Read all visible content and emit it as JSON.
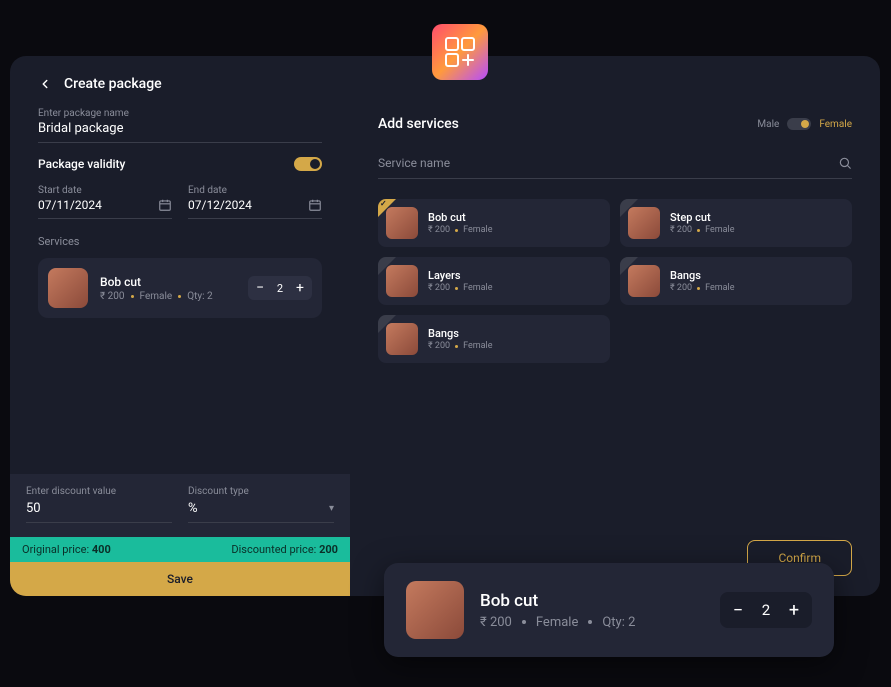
{
  "page_title": "Create package",
  "package_name_label": "Enter package name",
  "package_name_value": "Bridal package",
  "validity_label": "Package validity",
  "start_date_label": "Start date",
  "start_date_value": "07/11/2024",
  "end_date_label": "End date",
  "end_date_value": "07/12/2024",
  "services_label": "Services",
  "chosen_service": {
    "name": "Bob cut",
    "price": "₹ 200",
    "gender": "Female",
    "qty_label": "Qty: 2",
    "qty": "2"
  },
  "discount_label": "Enter discount value",
  "discount_value": "50",
  "discount_type_label": "Discount type",
  "discount_type_value": "%",
  "original_price_label": "Original price:",
  "original_price_value": "400",
  "discounted_price_label": "Discounted price:",
  "discounted_price_value": "200",
  "save_label": "Save",
  "add_services_title": "Add services",
  "gender_male": "Male",
  "gender_female": "Female",
  "search_placeholder": "Service name",
  "grid": [
    {
      "name": "Bob cut",
      "price": "₹ 200",
      "gender": "Female",
      "selected": true
    },
    {
      "name": "Step cut",
      "price": "₹ 200",
      "gender": "Female",
      "selected": false
    },
    {
      "name": "Layers",
      "price": "₹ 200",
      "gender": "Female",
      "selected": false
    },
    {
      "name": "Bangs",
      "price": "₹ 200",
      "gender": "Female",
      "selected": false
    },
    {
      "name": "Bangs",
      "price": "₹ 200",
      "gender": "Female",
      "selected": false
    }
  ],
  "confirm_label": "Confirm",
  "float": {
    "name": "Bob cut",
    "price": "₹ 200",
    "gender": "Female",
    "qty_label": "Qty: 2",
    "qty": "2"
  }
}
